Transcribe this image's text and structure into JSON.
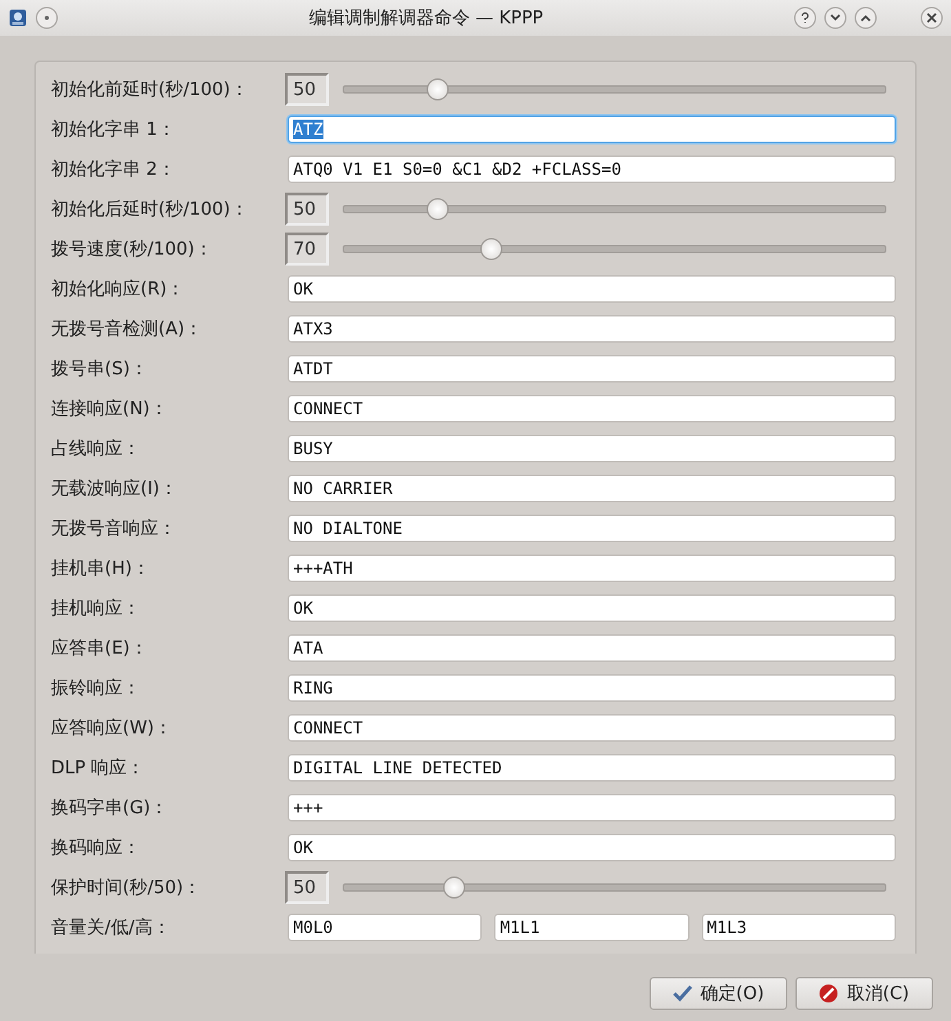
{
  "window": {
    "title": "编辑调制解调器命令 — KPPP"
  },
  "rows": [
    {
      "kind": "spin",
      "label": "初始化前延时(秒/100)：",
      "value": "50",
      "level": 0.17
    },
    {
      "kind": "text",
      "label": "初始化字串 1：",
      "value": "ATZ",
      "focused": true
    },
    {
      "kind": "text",
      "label": "初始化字串 2：",
      "value": "ATQ0 V1 E1 S0=0 &C1 &D2 +FCLASS=0",
      "focused": false
    },
    {
      "kind": "spin",
      "label": "初始化后延时(秒/100)：",
      "value": "50",
      "level": 0.17
    },
    {
      "kind": "spin",
      "label": "拨号速度(秒/100)：",
      "value": "70",
      "level": 0.27
    },
    {
      "kind": "text",
      "label": "初始化响应(R)：",
      "value": "OK",
      "focused": false
    },
    {
      "kind": "text",
      "label": "无拨号音检测(A)：",
      "value": "ATX3",
      "focused": false
    },
    {
      "kind": "text",
      "label": "拨号串(S)：",
      "value": "ATDT",
      "focused": false
    },
    {
      "kind": "text",
      "label": "连接响应(N)：",
      "value": "CONNECT",
      "focused": false
    },
    {
      "kind": "text",
      "label": "占线响应：",
      "value": "BUSY",
      "focused": false
    },
    {
      "kind": "text",
      "label": "无载波响应(I)：",
      "value": "NO CARRIER",
      "focused": false
    },
    {
      "kind": "text",
      "label": "无拨号音响应：",
      "value": "NO DIALTONE",
      "focused": false
    },
    {
      "kind": "text",
      "label": "挂机串(H)：",
      "value": "+++ATH",
      "focused": false
    },
    {
      "kind": "text",
      "label": "挂机响应：",
      "value": "OK",
      "focused": false
    },
    {
      "kind": "text",
      "label": "应答串(E)：",
      "value": "ATA",
      "focused": false
    },
    {
      "kind": "text",
      "label": "振铃响应：",
      "value": "RING",
      "focused": false
    },
    {
      "kind": "text",
      "label": "应答响应(W)：",
      "value": "CONNECT",
      "focused": false
    },
    {
      "kind": "text",
      "label": "DLP 响应：",
      "value": "DIGITAL LINE DETECTED",
      "focused": false
    },
    {
      "kind": "text",
      "label": "换码字串(G)：",
      "value": "+++",
      "focused": false
    },
    {
      "kind": "text",
      "label": "换码响应：",
      "value": "OK",
      "focused": false
    },
    {
      "kind": "spin",
      "label": "保护时间(秒/50)：",
      "value": "50",
      "level": 0.2
    },
    {
      "kind": "triple",
      "label": "音量关/低/高：",
      "values": [
        "M0L0",
        "M1L1",
        "M1L3"
      ]
    }
  ],
  "buttons": [
    {
      "kind": "ok",
      "label": "确定(O)"
    },
    {
      "kind": "cancel",
      "label": "取消(C)"
    }
  ]
}
